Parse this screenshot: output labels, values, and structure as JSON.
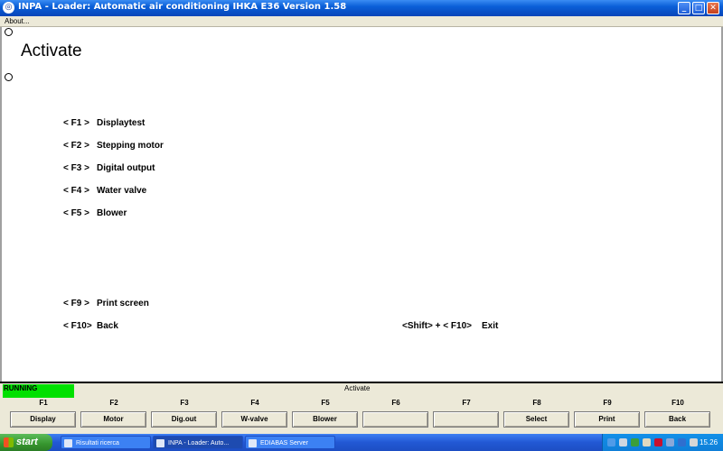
{
  "window": {
    "title": "INPA - Loader:  Automatic air conditioning IHKA E36 Version 1.58",
    "minimize": "_",
    "maximize": "□",
    "close": "✕"
  },
  "menu": {
    "about": "About..."
  },
  "page": {
    "title": "Activate",
    "options": [
      {
        "key": "< F1 >",
        "label": "Displaytest"
      },
      {
        "key": "< F2 >",
        "label": "Stepping motor"
      },
      {
        "key": "< F3 >",
        "label": "Digital output"
      },
      {
        "key": "< F4 >",
        "label": "Water valve"
      },
      {
        "key": "< F5 >",
        "label": "Blower"
      },
      {
        "key": "< F9 >",
        "label": "Print screen"
      },
      {
        "key": "< F10>",
        "label": "Back"
      }
    ],
    "exit": {
      "key": "<Shift> + < F10>",
      "label": "Exit"
    }
  },
  "footer": {
    "status": "RUNNING",
    "status_color": "#00e000",
    "title": "Activate",
    "fkeys": [
      {
        "key": "F1",
        "label": "Display"
      },
      {
        "key": "F2",
        "label": "Motor"
      },
      {
        "key": "F3",
        "label": "Dig.out"
      },
      {
        "key": "F4",
        "label": "W-valve"
      },
      {
        "key": "F5",
        "label": "Blower"
      },
      {
        "key": "F6",
        "label": ""
      },
      {
        "key": "F7",
        "label": ""
      },
      {
        "key": "F8",
        "label": "Select"
      },
      {
        "key": "F9",
        "label": "Print"
      },
      {
        "key": "F10",
        "label": "Back"
      }
    ]
  },
  "taskbar": {
    "start": "start",
    "tasks": [
      {
        "label": "Risultati ricerca",
        "icon": "folder-search-icon"
      },
      {
        "label": "INPA - Loader:  Auto...",
        "icon": "inpa-icon"
      },
      {
        "label": "EDIABAS Server",
        "icon": "ediabas-icon"
      }
    ],
    "clock": "15.26"
  }
}
